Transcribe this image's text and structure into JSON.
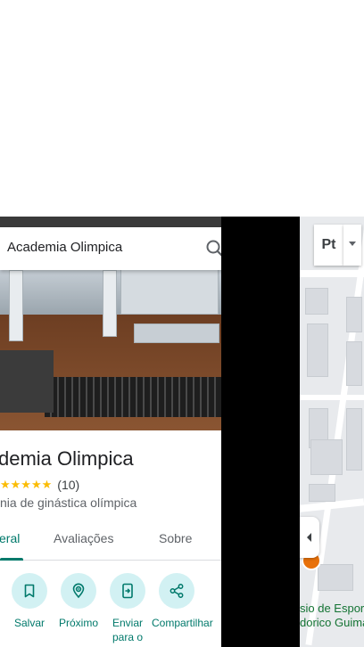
{
  "search": {
    "query": "Academia Olimpica",
    "search_icon": "search-icon",
    "close_icon": "close-icon"
  },
  "place": {
    "title": "demia Olimpica",
    "rating": "★★★★★",
    "review_count": "(10)",
    "category": "nia de ginástica olímpica"
  },
  "tabs": [
    {
      "label": "eral",
      "active": true
    },
    {
      "label": "Avaliações",
      "active": false
    },
    {
      "label": "Sobre",
      "active": false
    }
  ],
  "actions": [
    {
      "label": "Salvar",
      "icon": "bookmark-icon"
    },
    {
      "label": "Próximo",
      "icon": "nearby-icon"
    },
    {
      "label": "Enviar para o",
      "icon": "send-to-phone-icon"
    },
    {
      "label": "Compartilhar",
      "icon": "share-icon"
    }
  ],
  "map": {
    "layer_label": "Pt",
    "place_label_line1": "sio de Espor",
    "place_label_line2": "dorico Guima"
  },
  "colors": {
    "accent": "#00796b",
    "action_bg": "#d2f1f3",
    "star": "#fbbc04"
  }
}
